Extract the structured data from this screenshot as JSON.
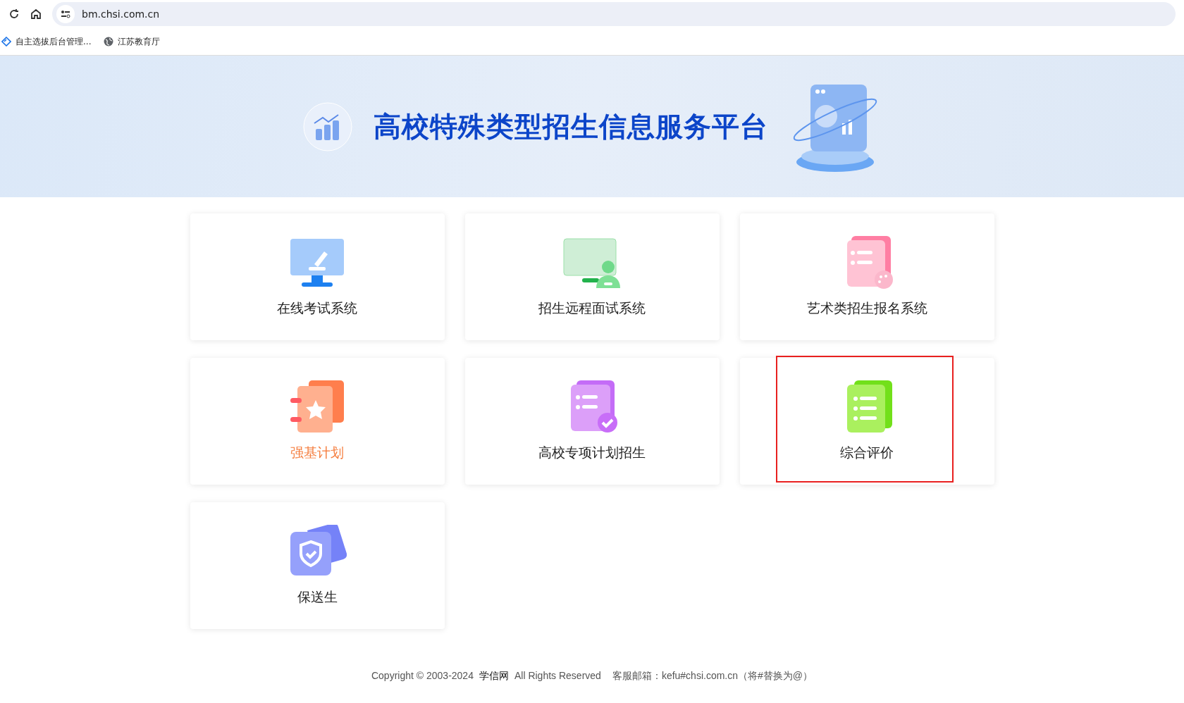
{
  "browser": {
    "url": "bm.chsi.com.cn",
    "bookmarks": [
      {
        "kind": "app",
        "label": "自主选拔后台管理..."
      },
      {
        "kind": "globe",
        "label": "江苏教育厅"
      }
    ]
  },
  "banner": {
    "title": "高校特殊类型招生信息服务平台"
  },
  "cards": [
    {
      "kind": "monitor-pen",
      "label": "在线考试系统",
      "highlighted": false,
      "outlined": false
    },
    {
      "kind": "monitor-person",
      "label": "招生远程面试系统",
      "highlighted": false,
      "outlined": false
    },
    {
      "kind": "document-palette",
      "label": "艺术类招生报名系统",
      "highlighted": false,
      "outlined": false
    },
    {
      "kind": "notebook-star",
      "label": "强基计划",
      "highlighted": true,
      "outlined": false
    },
    {
      "kind": "document-check",
      "label": "高校专项计划招生",
      "highlighted": false,
      "outlined": false
    },
    {
      "kind": "document-list",
      "label": "综合评价",
      "highlighted": false,
      "outlined": true
    },
    {
      "kind": "shield",
      "label": "保送生",
      "highlighted": false,
      "outlined": false
    }
  ],
  "footer": {
    "prefix": "Copyright © 2003-2024",
    "brand": "学信网",
    "rights": "All Rights Reserved",
    "contact": "客服邮箱：kefu#chsi.com.cn（将#替换为@）"
  }
}
